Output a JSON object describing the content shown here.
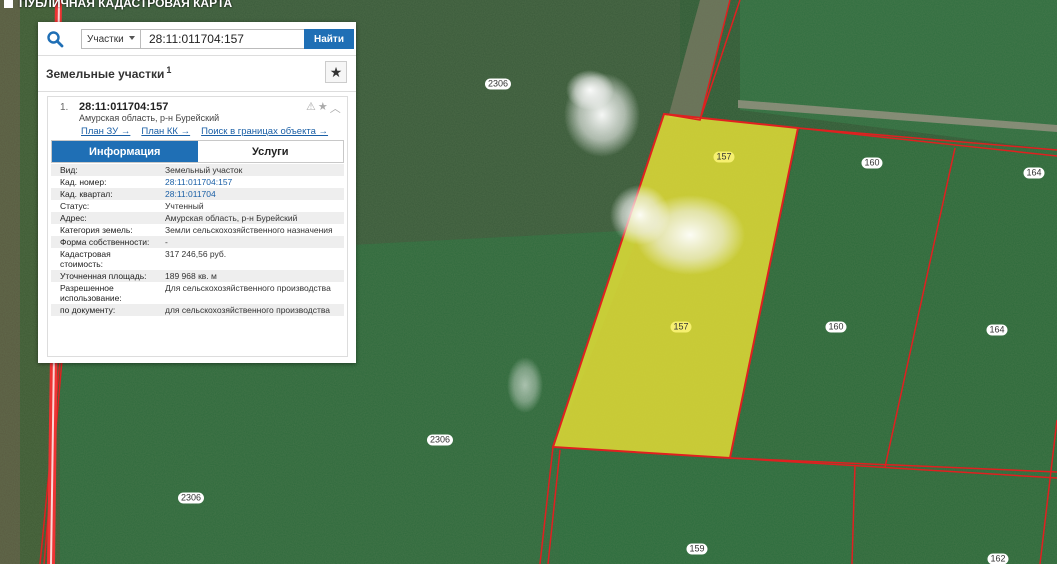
{
  "app": {
    "title": "ПУБЛИЧНАЯ КАДАСТРОВАЯ КАРТА"
  },
  "search": {
    "type_label": "Участки",
    "value": "28:11:011704:157",
    "placeholder": "",
    "button_label": "Найти"
  },
  "results": {
    "title": "Земельные участки",
    "count": "1"
  },
  "card": {
    "index": "1.",
    "title": "28:11:011704:157",
    "subtitle": "Амурская область, р-н Бурейский",
    "links": [
      "План ЗУ →",
      "План КК →",
      "Поиск в границах объекта →"
    ],
    "tabs": [
      "Информация",
      "Услуги"
    ],
    "rows": [
      {
        "label": "Вид:",
        "value": "Земельный участок"
      },
      {
        "label": "Кад. номер:",
        "value": "28:11:011704:157"
      },
      {
        "label": "Кад. квартал:",
        "value": "28:11:011704"
      },
      {
        "label": "Статус:",
        "value": "Учтенный"
      },
      {
        "label": "Адрес:",
        "value": "Амурская область, р-н Бурейский"
      },
      {
        "label": "Категория земель:",
        "value": "Земли сельскохозяйственного назначения"
      },
      {
        "label": "Форма собственности:",
        "value": "-"
      },
      {
        "label": "Кадастровая стоимость:",
        "value": "317 246,56 руб."
      },
      {
        "label": "Уточненная площадь:",
        "value": "189 968 кв. м"
      },
      {
        "label": "Разрешенное использование:",
        "value": "Для сельскохозяйственного производства"
      },
      {
        "label": "по документу:",
        "value": "для сельскохозяйственного производства"
      }
    ]
  },
  "map": {
    "labels": [
      "2306",
      "157",
      "160",
      "164",
      "157",
      "160",
      "164",
      "2306",
      "2306",
      "159",
      "162"
    ]
  },
  "colors": {
    "accent": "#1f6fb5",
    "link": "#1a5fa6",
    "parcel_border": "#e02020",
    "selected_fill": "#e8e236"
  }
}
